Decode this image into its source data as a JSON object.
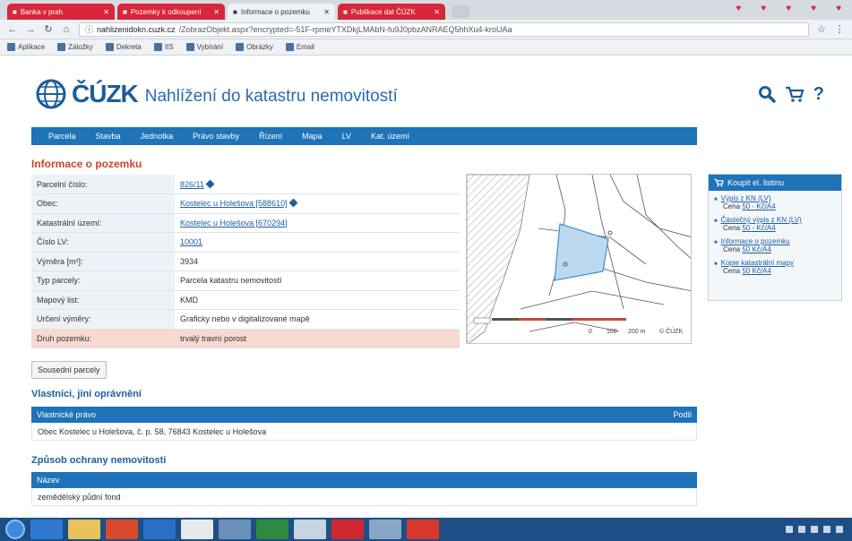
{
  "browser": {
    "tabs": [
      {
        "label": "Banka v prah",
        "style": "red"
      },
      {
        "label": "Pozemky k odkoupení",
        "style": "red"
      },
      {
        "label": "Informace o pozemku",
        "style": "active"
      },
      {
        "label": "Publikace dat ČÚZK",
        "style": "red"
      }
    ],
    "url_host": "nahlizenidokn.cuzk.cz",
    "url_path": "/ZobrazObjekt.aspx?encrypted=-51F-rpmeYTXDkjLMAbN-fu9J0pbzANRAEQ5hhXu4-kroUAa",
    "bookmarks": [
      "Aplikace",
      "Záložky",
      "Dekreta",
      "IIS",
      "Vybírání",
      "Obrázky",
      "Email"
    ]
  },
  "header": {
    "logo_text": "ČÚZK",
    "site_title": "Nahlížení do katastru nemovitostí",
    "icons": [
      "search-icon",
      "cart-icon",
      "help-icon"
    ]
  },
  "nav": {
    "items": [
      "Parcela",
      "Stavba",
      "Jednotka",
      "Právo stavby",
      "Řízení",
      "Mapa",
      "LV",
      "Kat. území"
    ]
  },
  "parcel": {
    "title": "Informace o pozemku",
    "rows": [
      {
        "label": "Parcelní číslo:",
        "value": "826/11",
        "link": true,
        "pencil": true
      },
      {
        "label": "Obec:",
        "value": "Kostelec u Holešova [588610]",
        "link": true,
        "pencil": true
      },
      {
        "label": "Katastrální území:",
        "value": "Kostelec u Holešova [670294]",
        "link": true,
        "pencil": false
      },
      {
        "label": "Číslo LV:",
        "value": "10001",
        "link": true,
        "pencil": false
      },
      {
        "label": "Výměra [m²]:",
        "value": "3934",
        "link": false,
        "pencil": false
      },
      {
        "label": "Typ parcely:",
        "value": "Parcela katastru nemovitostí",
        "link": false,
        "pencil": false
      },
      {
        "label": "Mapový list:",
        "value": "KMD",
        "link": false,
        "pencil": false
      },
      {
        "label": "Určení výměry:",
        "value": "Graficky nebo v digitalizované mapě",
        "link": false,
        "pencil": false
      },
      {
        "label": "Druh pozemku:",
        "value": "trvalý travní porost",
        "link": false,
        "pencil": false,
        "highlight": true
      }
    ],
    "neighbors_button": "Sousední parcely"
  },
  "map": {
    "scale_labels": [
      "0",
      "100",
      "200 m"
    ],
    "watermark": "© ČÚZK",
    "parcel_color": "#bcd9ef"
  },
  "owners": {
    "title": "Vlastníci, jiní oprávnění",
    "header_left": "Vlastnické právo",
    "header_right": "Podíl",
    "row": "Obec Kostelec u Holešova, č. p. 58, 76843 Kostelec u Holešova"
  },
  "protection": {
    "title": "Způsob ochrany nemovitosti",
    "header": "Název",
    "row": "zemědělský půdní fond"
  },
  "sidebar": {
    "title": "Koupit el. listinu",
    "items": [
      {
        "label": "Výpis z KN (LV)",
        "price_prefix": "Cena",
        "price": "50 - Kč/A4"
      },
      {
        "label": "Částečný výpis z KN (LV)",
        "price_prefix": "Cena",
        "price": "50 - Kč/A4"
      },
      {
        "label": "Informace o pozemku",
        "price_prefix": "Cena",
        "price": "50 Kč/A4"
      },
      {
        "label": "Kopie katastrální mapy",
        "price_prefix": "Cena",
        "price": "50 Kč/A4"
      }
    ]
  },
  "colors": {
    "accent": "#1f73b8",
    "heading_red": "#c7452b",
    "highlight_row": "#f6d9cf",
    "tab_red": "#d8263a"
  }
}
